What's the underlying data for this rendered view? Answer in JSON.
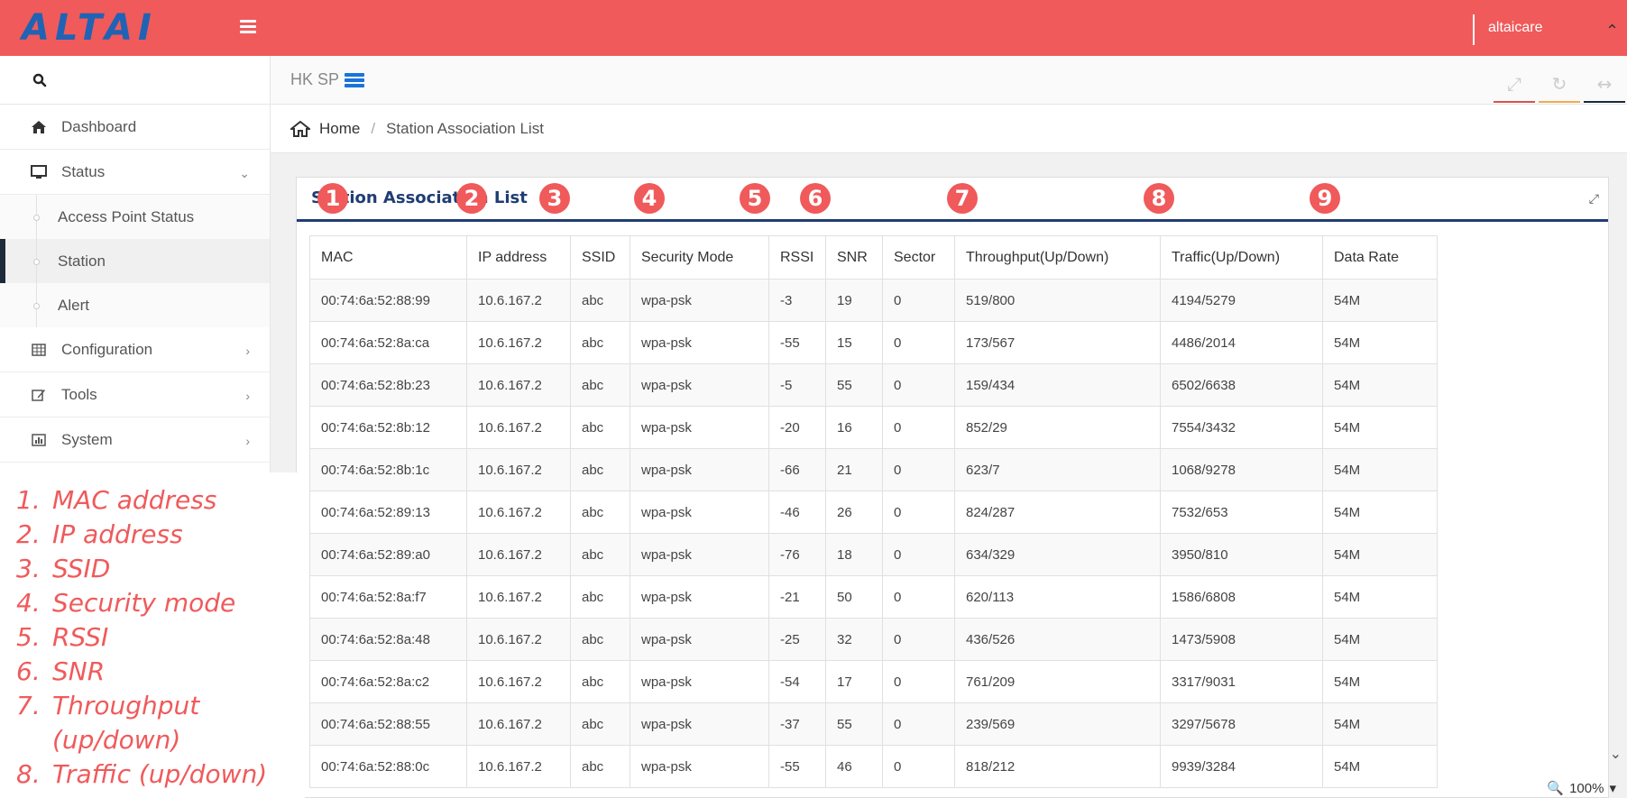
{
  "header": {
    "logo": "ALTAI",
    "user": "altaicare"
  },
  "sidebar": {
    "items": [
      {
        "label": "Dashboard",
        "icon": "home-icon"
      },
      {
        "label": "Status",
        "icon": "monitor-icon",
        "expanded": true
      },
      {
        "label": "Configuration",
        "icon": "table-icon"
      },
      {
        "label": "Tools",
        "icon": "edit-icon"
      },
      {
        "label": "System",
        "icon": "chart-icon"
      }
    ],
    "status_sub": [
      {
        "label": "Access Point Status"
      },
      {
        "label": "Station",
        "active": true
      },
      {
        "label": "Alert"
      }
    ]
  },
  "topbar": {
    "site": "HK SP"
  },
  "breadcrumb": {
    "home": "Home",
    "sep": "/",
    "current": "Station Association List"
  },
  "panel": {
    "title": "Station Association List"
  },
  "table": {
    "headers": [
      "MAC",
      "IP address",
      "SSID",
      "Security Mode",
      "RSSI",
      "SNR",
      "Sector",
      "Throughput(Up/Down)",
      "Traffic(Up/Down)",
      "Data Rate"
    ],
    "rows": [
      [
        "00:74:6a:52:88:99",
        "10.6.167.2",
        "abc",
        "wpa-psk",
        "-3",
        "19",
        "0",
        "519/800",
        "4194/5279",
        "54M"
      ],
      [
        "00:74:6a:52:8a:ca",
        "10.6.167.2",
        "abc",
        "wpa-psk",
        "-55",
        "15",
        "0",
        "173/567",
        "4486/2014",
        "54M"
      ],
      [
        "00:74:6a:52:8b:23",
        "10.6.167.2",
        "abc",
        "wpa-psk",
        "-5",
        "55",
        "0",
        "159/434",
        "6502/6638",
        "54M"
      ],
      [
        "00:74:6a:52:8b:12",
        "10.6.167.2",
        "abc",
        "wpa-psk",
        "-20",
        "16",
        "0",
        "852/29",
        "7554/3432",
        "54M"
      ],
      [
        "00:74:6a:52:8b:1c",
        "10.6.167.2",
        "abc",
        "wpa-psk",
        "-66",
        "21",
        "0",
        "623/7",
        "1068/9278",
        "54M"
      ],
      [
        "00:74:6a:52:89:13",
        "10.6.167.2",
        "abc",
        "wpa-psk",
        "-46",
        "26",
        "0",
        "824/287",
        "7532/653",
        "54M"
      ],
      [
        "00:74:6a:52:89:a0",
        "10.6.167.2",
        "abc",
        "wpa-psk",
        "-76",
        "18",
        "0",
        "634/329",
        "3950/810",
        "54M"
      ],
      [
        "00:74:6a:52:8a:f7",
        "10.6.167.2",
        "abc",
        "wpa-psk",
        "-21",
        "50",
        "0",
        "620/113",
        "1586/6808",
        "54M"
      ],
      [
        "00:74:6a:52:8a:48",
        "10.6.167.2",
        "abc",
        "wpa-psk",
        "-25",
        "32",
        "0",
        "436/526",
        "1473/5908",
        "54M"
      ],
      [
        "00:74:6a:52:8a:c2",
        "10.6.167.2",
        "abc",
        "wpa-psk",
        "-54",
        "17",
        "0",
        "761/209",
        "3317/9031",
        "54M"
      ],
      [
        "00:74:6a:52:88:55",
        "10.6.167.2",
        "abc",
        "wpa-psk",
        "-37",
        "55",
        "0",
        "239/569",
        "3297/5678",
        "54M"
      ],
      [
        "00:74:6a:52:88:0c",
        "10.6.167.2",
        "abc",
        "wpa-psk",
        "-55",
        "46",
        "0",
        "818/212",
        "9939/3284",
        "54M"
      ]
    ]
  },
  "badges": [
    "1",
    "2",
    "3",
    "4",
    "5",
    "6",
    "7",
    "8",
    "9"
  ],
  "legend": [
    {
      "num": "1.",
      "text": "MAC address"
    },
    {
      "num": "2.",
      "text": "IP address"
    },
    {
      "num": "3.",
      "text": "SSID"
    },
    {
      "num": "4.",
      "text": "Security mode"
    },
    {
      "num": "5.",
      "text": "RSSI"
    },
    {
      "num": "6.",
      "text": "SNR"
    },
    {
      "num": "7.",
      "text": "Throughput"
    },
    {
      "num": "",
      "text": "(up/down)"
    },
    {
      "num": "8.",
      "text": "Traffic (up/down)"
    }
  ],
  "status": {
    "zoom": "100%"
  },
  "colors": {
    "topbar": "#f05a5b",
    "brand": "#1f63b5",
    "panel_title": "#1f3d73"
  }
}
